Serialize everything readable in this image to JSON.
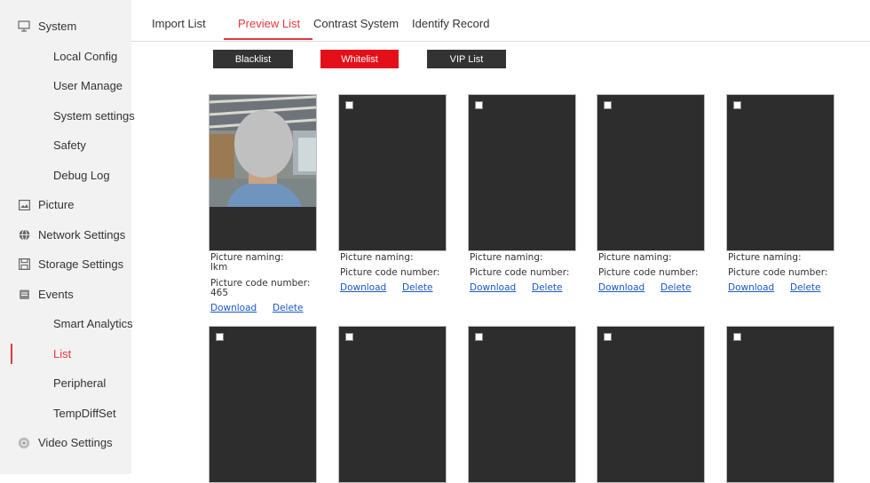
{
  "sidebar": {
    "items": [
      {
        "label": "System",
        "icon": "monitor-icon",
        "level": 1
      },
      {
        "label": "Local Config",
        "level": 2
      },
      {
        "label": "User Manage",
        "level": 2
      },
      {
        "label": "System settings",
        "level": 2
      },
      {
        "label": "Safety",
        "level": 2
      },
      {
        "label": "Debug Log",
        "level": 2
      },
      {
        "label": "Picture",
        "icon": "picture-icon",
        "level": 1
      },
      {
        "label": "Network Settings",
        "icon": "globe-icon",
        "level": 1
      },
      {
        "label": "Storage Settings",
        "icon": "floppy-icon",
        "level": 1
      },
      {
        "label": "Events",
        "icon": "events-icon",
        "level": 1
      },
      {
        "label": "Smart Analytics",
        "level": 2
      },
      {
        "label": "List",
        "level": 2,
        "active": true
      },
      {
        "label": "Peripheral",
        "level": 2
      },
      {
        "label": "TempDiffSet",
        "level": 2
      },
      {
        "label": "Video Settings",
        "icon": "camera-icon",
        "level": 1
      }
    ]
  },
  "tabs": [
    "Import List",
    "Preview List",
    "Contrast System",
    "Identify Record"
  ],
  "active_tab": "Preview List",
  "list_buttons": [
    "Blacklist",
    "Whitelist",
    "VIP List"
  ],
  "active_list": "Whitelist",
  "cards": [
    {
      "naming_label": "Picture naming:",
      "naming_value": "lkm",
      "code_label": "Picture code number:",
      "code_value": "465",
      "download": "Download",
      "delete": "Delete",
      "has_photo": true
    },
    {
      "naming_label": "Picture naming:",
      "naming_value": "",
      "code_label": "Picture code number:",
      "code_value": "",
      "download": "Download",
      "delete": "Delete"
    },
    {
      "naming_label": "Picture naming:",
      "naming_value": "",
      "code_label": "Picture code number:",
      "code_value": "",
      "download": "Download",
      "delete": "Delete"
    },
    {
      "naming_label": "Picture naming:",
      "naming_value": "",
      "code_label": "Picture code number:",
      "code_value": "",
      "download": "Download",
      "delete": "Delete"
    },
    {
      "naming_label": "Picture naming:",
      "naming_value": "",
      "code_label": "Picture code number:",
      "code_value": "",
      "download": "Download",
      "delete": "Delete"
    }
  ],
  "colors": {
    "accent": "#e4393c",
    "button_dark": "#333333",
    "button_active": "#e3101a",
    "link": "#1a57c8",
    "card_bg": "#2d2d2d"
  }
}
